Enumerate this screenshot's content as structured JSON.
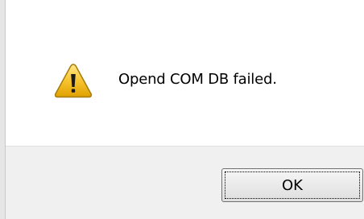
{
  "dialog": {
    "icon": "warning-icon",
    "message": "Opend COM DB failed.",
    "ok_label": "OK"
  },
  "colors": {
    "warning_yellow": "#f7c430",
    "warning_outline": "#a57c0a",
    "button_bar": "#f0f0f0"
  }
}
